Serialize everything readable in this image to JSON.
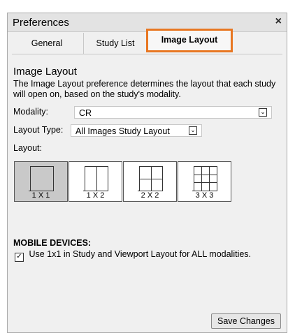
{
  "window": {
    "title": "Preferences"
  },
  "tabs": [
    {
      "label": "General"
    },
    {
      "label": "Study List"
    },
    {
      "label": "Image Layout"
    }
  ],
  "section": {
    "title": "Image Layout",
    "description": "The Image Layout preference determines the layout that each study will open on, based on the study's modality."
  },
  "fields": {
    "modality": {
      "label": "Modality:",
      "value": "CR"
    },
    "layout_type": {
      "label": "Layout Type:",
      "value": "All Images Study Layout"
    },
    "layout": {
      "label": "Layout:"
    }
  },
  "layouts": [
    {
      "label": "1 X 1",
      "selected": true
    },
    {
      "label": "1 X 2",
      "selected": false
    },
    {
      "label": "2 X 2",
      "selected": false
    },
    {
      "label": "3 X 3",
      "selected": false
    }
  ],
  "mobile": {
    "title": "MOBILE DEVICES:",
    "checkbox_label": "Use 1x1 in Study and Viewport Layout for ALL modalities.",
    "checked": true
  },
  "actions": {
    "save_label": "Save Changes"
  },
  "colors": {
    "active_tab_border": "#e87722",
    "selected_layout": "#c9c9c9"
  },
  "icons": {
    "close": "close-icon",
    "dropdown": "chevron-down-icon",
    "check": "checkmark-icon"
  }
}
